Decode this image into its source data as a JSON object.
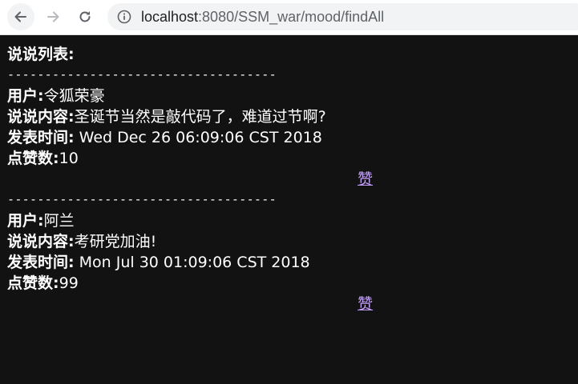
{
  "browser": {
    "url_host": "localhost",
    "url_path": ":8080/SSM_war/mood/findAll"
  },
  "page": {
    "heading": "说说列表:",
    "divider": "------------------------------------",
    "labels": {
      "user": "用户:",
      "content": "说说内容:",
      "time": "发表时间:",
      "likes": "点赞数:"
    },
    "like_link": "赞",
    "posts": [
      {
        "user": "令狐荣豪",
        "content": "圣诞节当然是敲代码了，难道过节啊?",
        "time": " Wed Dec 26 06:09:06 CST 2018",
        "likes": "10"
      },
      {
        "user": "阿兰",
        "content": "考研党加油!",
        "time": " Mon Jul 30 01:09:06 CST 2018",
        "likes": "99"
      }
    ]
  }
}
